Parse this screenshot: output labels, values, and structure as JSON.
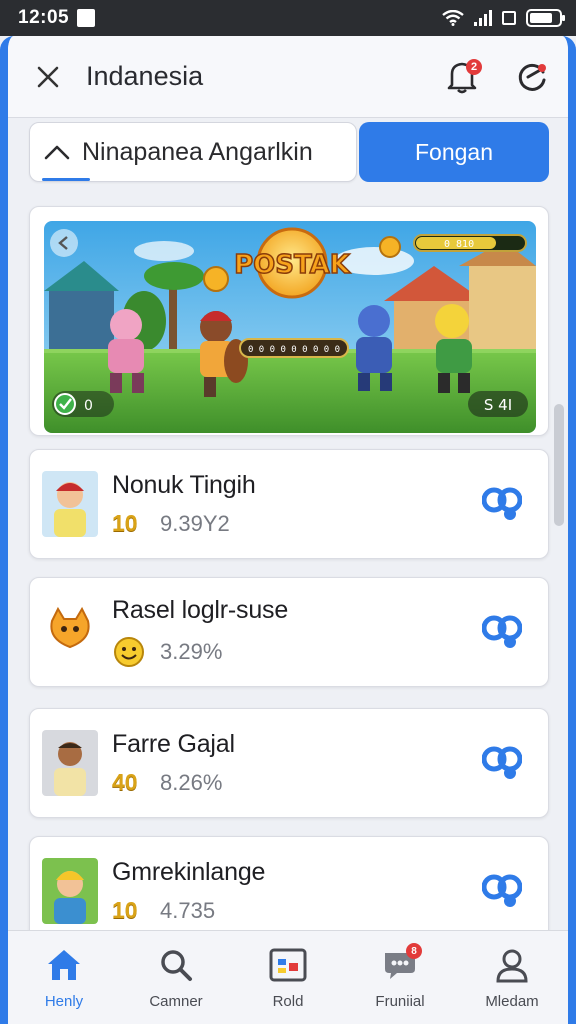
{
  "status_bar": {
    "time": "12:05"
  },
  "header": {
    "title": "Indanesia",
    "notification_count": "2"
  },
  "search": {
    "query": "Ninapanea Angarlkin",
    "button_label": "Fongan"
  },
  "banner": {
    "title": "POSTAK",
    "top_counter": "0 810",
    "score_display": "0 0 0 0 0 0 0 0 0",
    "bottom_left": "0",
    "bottom_right": "S 4I"
  },
  "list": [
    {
      "name": "Nonuk Tingih",
      "badge": "10",
      "value": "9.39Y2"
    },
    {
      "name": "Rasel loglr-suse",
      "badge": "",
      "value": "3.29%"
    },
    {
      "name": "Farre Gajal",
      "badge": "40",
      "value": "8.26%"
    },
    {
      "name": "Gmrekinlange",
      "badge": "10",
      "value": "4.735"
    }
  ],
  "bottom_nav": [
    {
      "label": "Henly",
      "icon": "home-icon",
      "active": true
    },
    {
      "label": "Camner",
      "icon": "search-icon"
    },
    {
      "label": "Rold",
      "icon": "board-icon"
    },
    {
      "label": "Fruniial",
      "icon": "chat-icon",
      "badge": "8"
    },
    {
      "label": "Mledam",
      "icon": "profile-icon"
    }
  ],
  "colors": {
    "accent": "#2f7be8",
    "badge_red": "#e23b3b",
    "gold": "#d9a318"
  }
}
